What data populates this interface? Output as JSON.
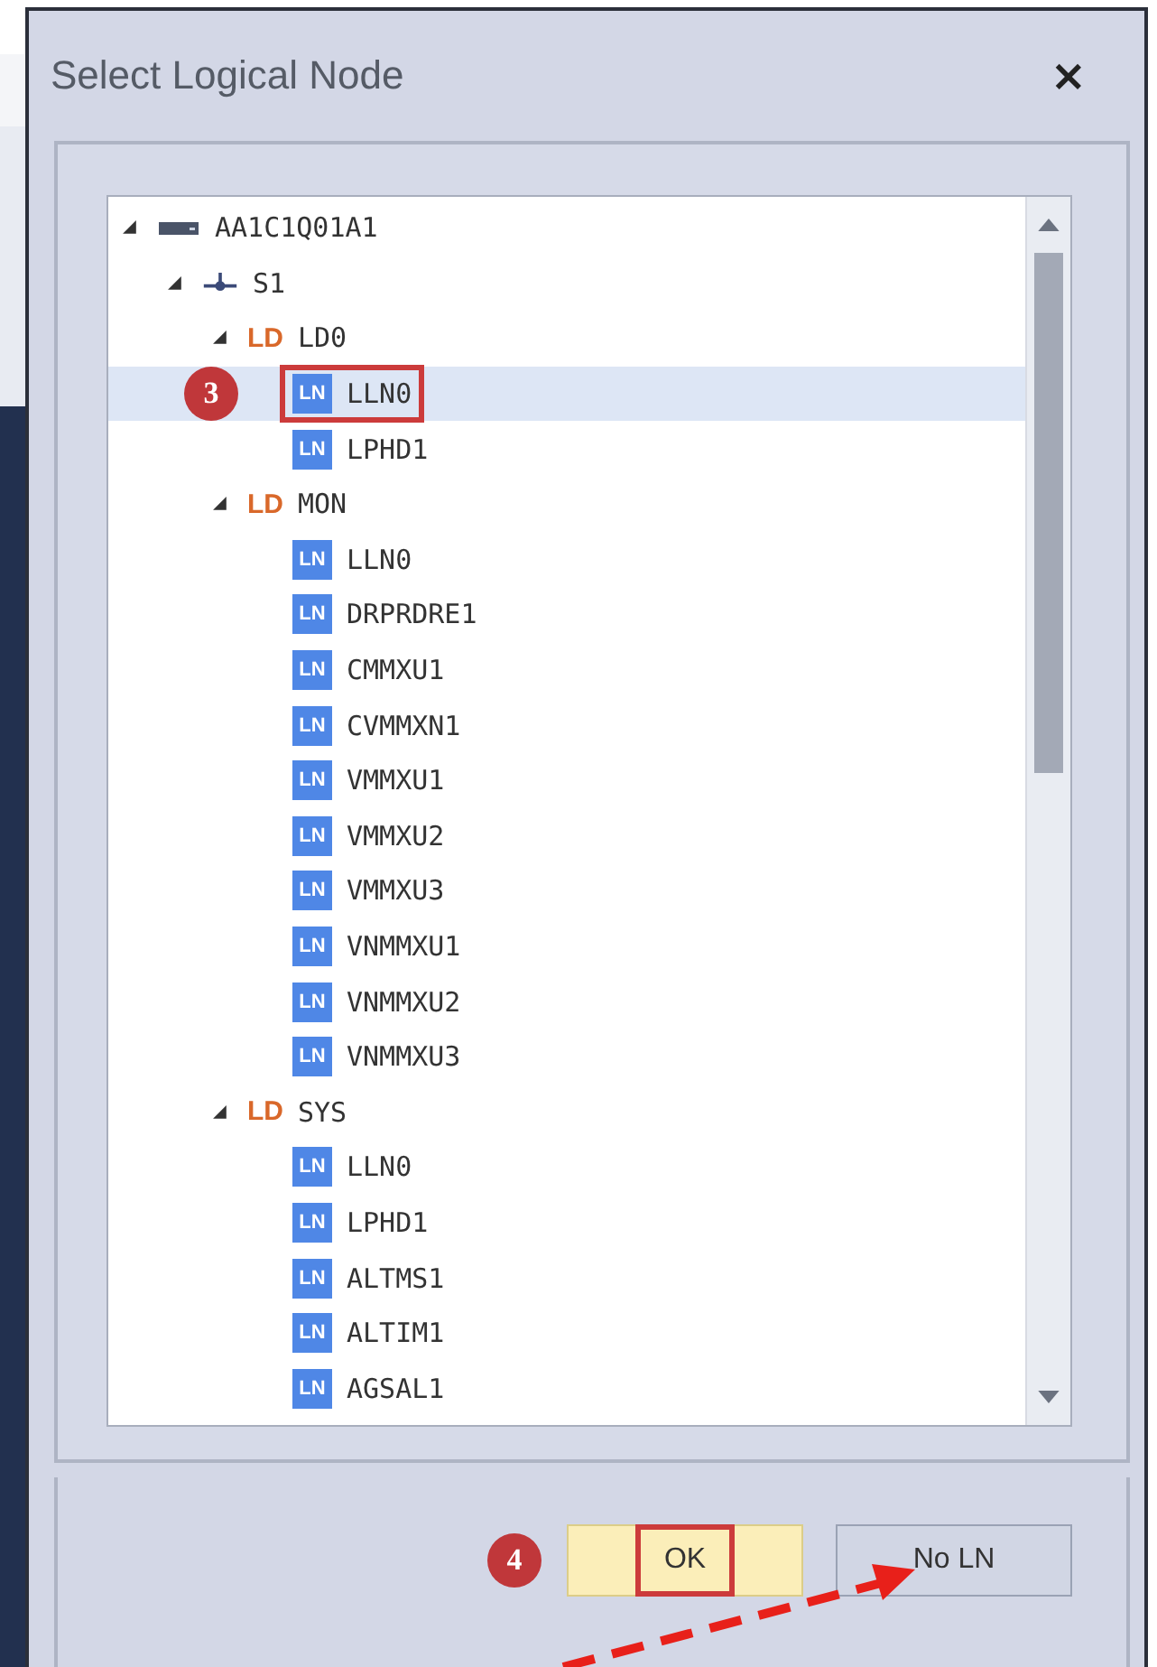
{
  "window": {
    "title": "Select Logical Node",
    "close": "×"
  },
  "tree": {
    "items": [
      {
        "kind": "device",
        "label": "AA1C1Q01A1",
        "expanded": true,
        "selected": false,
        "children": [
          {
            "kind": "server",
            "label": "S1",
            "expanded": true,
            "selected": false,
            "children": [
              {
                "kind": "ld",
                "badge": "LD",
                "label": "LD0",
                "expanded": true,
                "selected": false,
                "children": [
                  {
                    "kind": "ln",
                    "badge": "LN",
                    "label": "LLN0",
                    "selected": true,
                    "highlighted": true,
                    "callout": "3"
                  },
                  {
                    "kind": "ln",
                    "badge": "LN",
                    "label": "LPHD1",
                    "selected": false
                  }
                ]
              },
              {
                "kind": "ld",
                "badge": "LD",
                "label": "MON",
                "expanded": true,
                "selected": false,
                "children": [
                  {
                    "kind": "ln",
                    "badge": "LN",
                    "label": "LLN0",
                    "selected": false
                  },
                  {
                    "kind": "ln",
                    "badge": "LN",
                    "label": "DRPRDRE1",
                    "selected": false
                  },
                  {
                    "kind": "ln",
                    "badge": "LN",
                    "label": "CMMXU1",
                    "selected": false
                  },
                  {
                    "kind": "ln",
                    "badge": "LN",
                    "label": "CVMMXN1",
                    "selected": false
                  },
                  {
                    "kind": "ln",
                    "badge": "LN",
                    "label": "VMMXU1",
                    "selected": false
                  },
                  {
                    "kind": "ln",
                    "badge": "LN",
                    "label": "VMMXU2",
                    "selected": false
                  },
                  {
                    "kind": "ln",
                    "badge": "LN",
                    "label": "VMMXU3",
                    "selected": false
                  },
                  {
                    "kind": "ln",
                    "badge": "LN",
                    "label": "VNMMXU1",
                    "selected": false
                  },
                  {
                    "kind": "ln",
                    "badge": "LN",
                    "label": "VNMMXU2",
                    "selected": false
                  },
                  {
                    "kind": "ln",
                    "badge": "LN",
                    "label": "VNMMXU3",
                    "selected": false
                  }
                ]
              },
              {
                "kind": "ld",
                "badge": "LD",
                "label": "SYS",
                "expanded": true,
                "selected": false,
                "children": [
                  {
                    "kind": "ln",
                    "badge": "LN",
                    "label": "LLN0",
                    "selected": false
                  },
                  {
                    "kind": "ln",
                    "badge": "LN",
                    "label": "LPHD1",
                    "selected": false
                  },
                  {
                    "kind": "ln",
                    "badge": "LN",
                    "label": "ALTMS1",
                    "selected": false
                  },
                  {
                    "kind": "ln",
                    "badge": "LN",
                    "label": "ALTIM1",
                    "selected": false
                  },
                  {
                    "kind": "ln",
                    "badge": "LN",
                    "label": "AGSAL1",
                    "selected": false
                  }
                ]
              }
            ]
          }
        ]
      }
    ]
  },
  "buttons": [
    {
      "label": "OK",
      "kind": "primary",
      "highlighted": true,
      "callout": "4"
    },
    {
      "label": "No LN",
      "kind": "secondary",
      "highlighted": false
    }
  ]
}
